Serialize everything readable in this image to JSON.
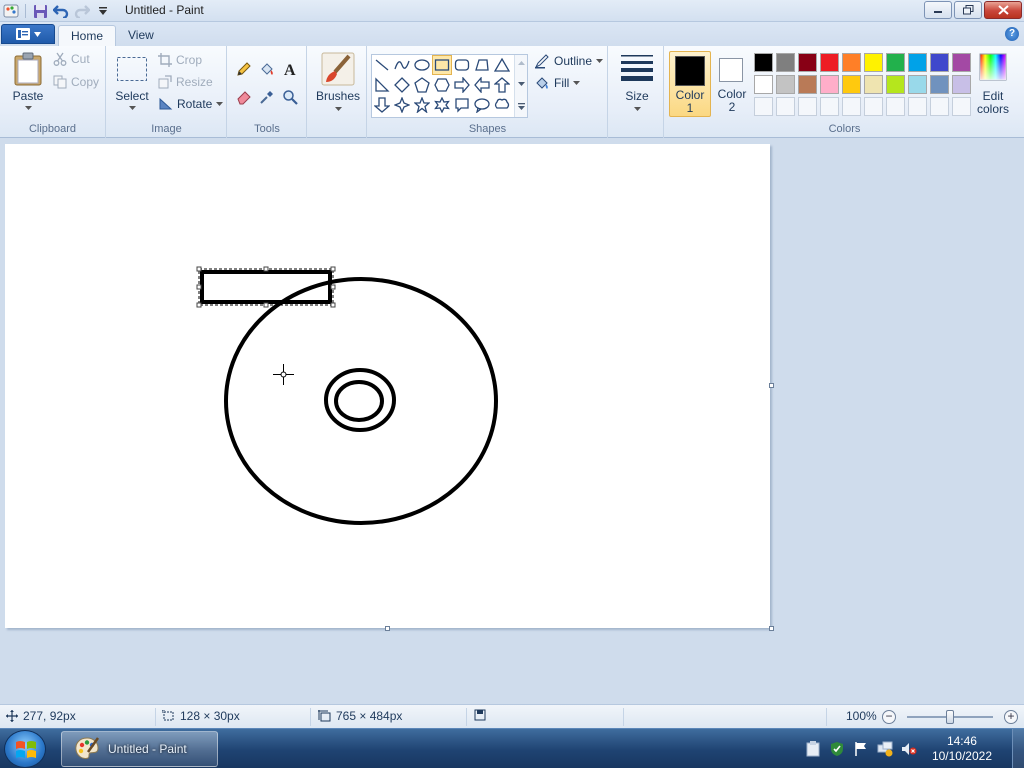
{
  "window": {
    "title": "Untitled - Paint"
  },
  "tabs": [
    {
      "label": "Home",
      "active": true
    },
    {
      "label": "View",
      "active": false
    }
  ],
  "clipboard": {
    "paste": "Paste",
    "cut": "Cut",
    "copy": "Copy",
    "label": "Clipboard"
  },
  "image": {
    "select": "Select",
    "crop": "Crop",
    "resize": "Resize",
    "rotate": "Rotate",
    "label": "Image"
  },
  "tools": {
    "label": "Tools"
  },
  "brushes": {
    "label": "Brushes"
  },
  "shapes": {
    "outline": "Outline",
    "fill": "Fill",
    "label": "Shapes"
  },
  "size": {
    "label": "Size"
  },
  "colors": {
    "color1_line1": "Color",
    "color1_line2": "1",
    "color2_line1": "Color",
    "color2_line2": "2",
    "edit_line1": "Edit",
    "edit_line2": "colors",
    "label": "Colors",
    "color1": "#000000",
    "color2": "#ffffff",
    "row1": [
      "#000000",
      "#7f7f7f",
      "#880015",
      "#ed1c24",
      "#ff7f27",
      "#fff200",
      "#22b14c",
      "#00a2e8",
      "#3f48cc",
      "#a349a4"
    ],
    "row2": [
      "#ffffff",
      "#c3c3c3",
      "#b97a57",
      "#ffaec9",
      "#ffc90e",
      "#efe4b0",
      "#b5e61d",
      "#99d9ea",
      "#7092be",
      "#c8bfe7"
    ]
  },
  "status": {
    "cursor_pos": "277, 92px",
    "selection_size": "128 × 30px",
    "canvas_size": "765 × 484px",
    "zoom": "100%",
    "zoom_level": 1.0
  },
  "taskbar": {
    "app_button": "Untitled - Paint",
    "time": "14:46",
    "date": "10/10/2022"
  }
}
